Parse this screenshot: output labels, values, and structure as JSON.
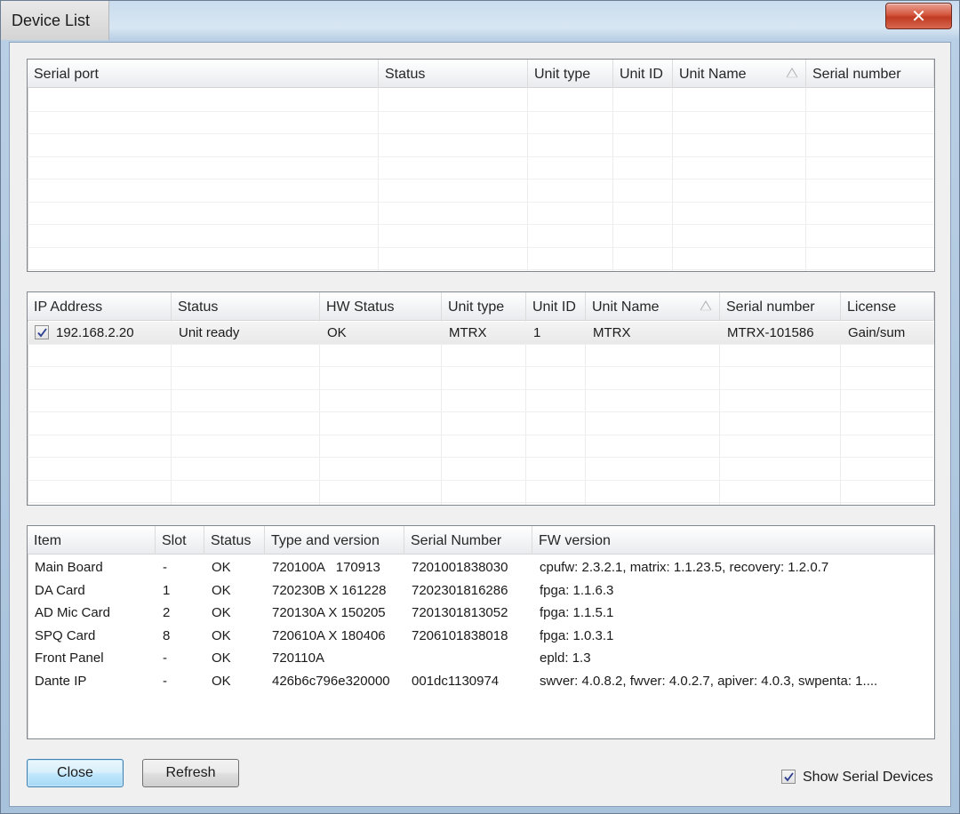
{
  "window": {
    "title": "Device List",
    "close_glyph": "✕"
  },
  "serial_table": {
    "columns": [
      "Serial port",
      "Status",
      "Unit type",
      "Unit ID",
      "Unit Name",
      "Serial number"
    ],
    "sorted_column": "Unit Name",
    "rows": []
  },
  "ip_table": {
    "columns": [
      "IP Address",
      "Status",
      "HW Status",
      "Unit type",
      "Unit ID",
      "Unit Name",
      "Serial number",
      "License"
    ],
    "sorted_column": "Unit Name",
    "rows": [
      {
        "checked": true,
        "ip": "192.168.2.20",
        "status": "Unit ready",
        "hw_status": "OK",
        "unit_type": "MTRX",
        "unit_id": "1",
        "unit_name": "MTRX",
        "serial": "MTRX-101586",
        "license": "Gain/sum"
      }
    ]
  },
  "items_table": {
    "columns": [
      "Item",
      "Slot",
      "Status",
      "Type and version",
      "Serial Number",
      "FW version"
    ],
    "rows": [
      [
        "Main Board",
        "-",
        "OK",
        "720100A   170913",
        "7201001838030",
        "cpufw: 2.3.2.1, matrix: 1.1.23.5, recovery: 1.2.0.7"
      ],
      [
        "DA Card",
        "1",
        "OK",
        "720230B X 161228",
        "7202301816286",
        "fpga: 1.1.6.3"
      ],
      [
        "AD Mic Card",
        "2",
        "OK",
        "720130A X 150205",
        "7201301813052",
        "fpga: 1.1.5.1"
      ],
      [
        "SPQ Card",
        "8",
        "OK",
        "720610A X 180406",
        "7206101838018",
        "fpga: 1.0.3.1"
      ],
      [
        "Front Panel",
        "-",
        "OK",
        "720110A",
        "",
        "epld: 1.3"
      ],
      [
        "Dante IP",
        "-",
        "OK",
        "426b6c796e320000",
        "001dc1130974",
        "swver: 4.0.8.2, fwver: 4.0.2.7, apiver: 4.0.3, swpenta: 1...."
      ]
    ]
  },
  "buttons": {
    "close_label": "Close",
    "refresh_label": "Refresh"
  },
  "show_serial": {
    "label": "Show Serial Devices",
    "checked": true
  }
}
